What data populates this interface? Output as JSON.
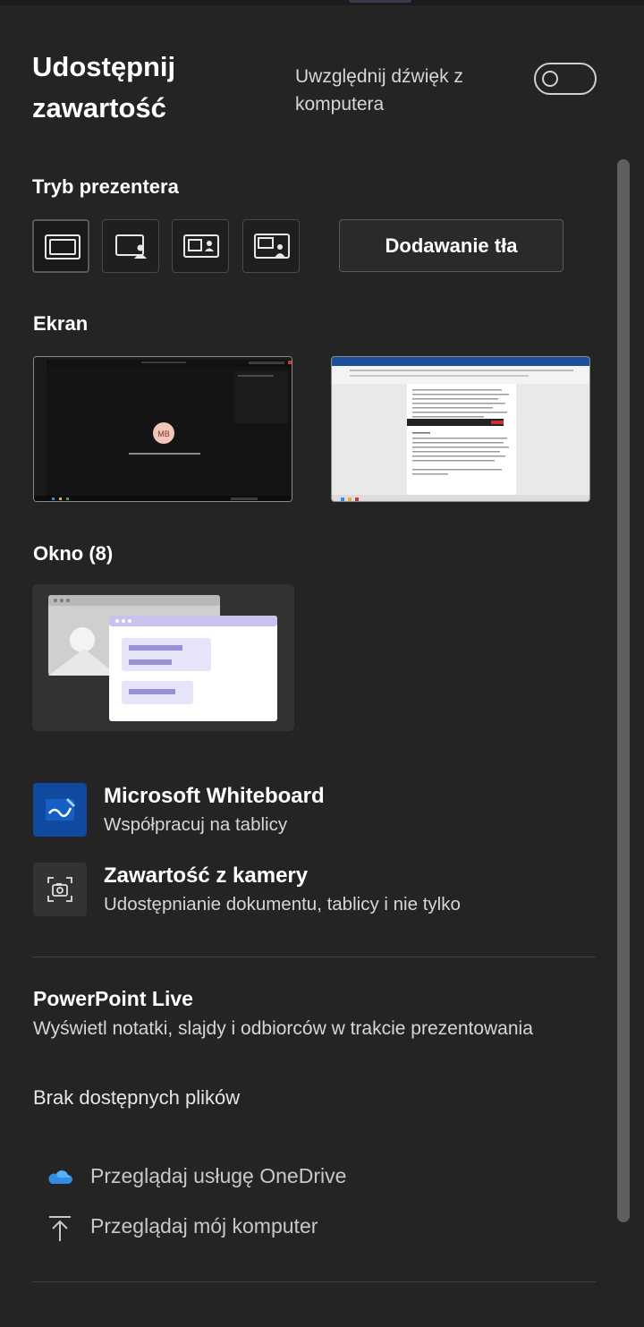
{
  "header": {
    "title": "Udostępnij zawartość",
    "audio_toggle_label": "Uwzględnij dźwięk z komputera",
    "audio_toggle_on": false
  },
  "presenter_mode": {
    "label": "Tryb prezentera",
    "modes": [
      {
        "icon": "content-only-icon",
        "selected": true
      },
      {
        "icon": "standout-icon",
        "selected": false
      },
      {
        "icon": "side-by-side-icon",
        "selected": false
      },
      {
        "icon": "reporter-icon",
        "selected": false
      }
    ],
    "background_button": "Dodawanie tła"
  },
  "screens": {
    "label": "Ekran",
    "thumb1_avatar_initials": "MB"
  },
  "windows": {
    "label": "Okno (8)"
  },
  "apps": [
    {
      "title": "Microsoft Whiteboard",
      "subtitle": "Współpracuj na tablicy",
      "icon": "whiteboard-icon"
    },
    {
      "title": "Zawartość z kamery",
      "subtitle": "Udostępnianie dokumentu, tablicy i nie tylko",
      "icon": "camera-icon"
    }
  ],
  "powerpoint": {
    "title": "PowerPoint Live",
    "subtitle": "Wyświetl notatki, slajdy i odbiorców w trakcie prezentowania",
    "no_files": "Brak dostępnych plików"
  },
  "browse": [
    {
      "label": "Przeglądaj usługę OneDrive",
      "icon": "onedrive-cloud-icon"
    },
    {
      "label": "Przeglądaj mój komputer",
      "icon": "upload-arrow-icon"
    }
  ],
  "colors": {
    "panel_bg": "#242424",
    "whiteboard_blue": "#0f4a9e",
    "onedrive_blue": "#2f8ee0",
    "illustration_purple": "#c7c3ec"
  }
}
